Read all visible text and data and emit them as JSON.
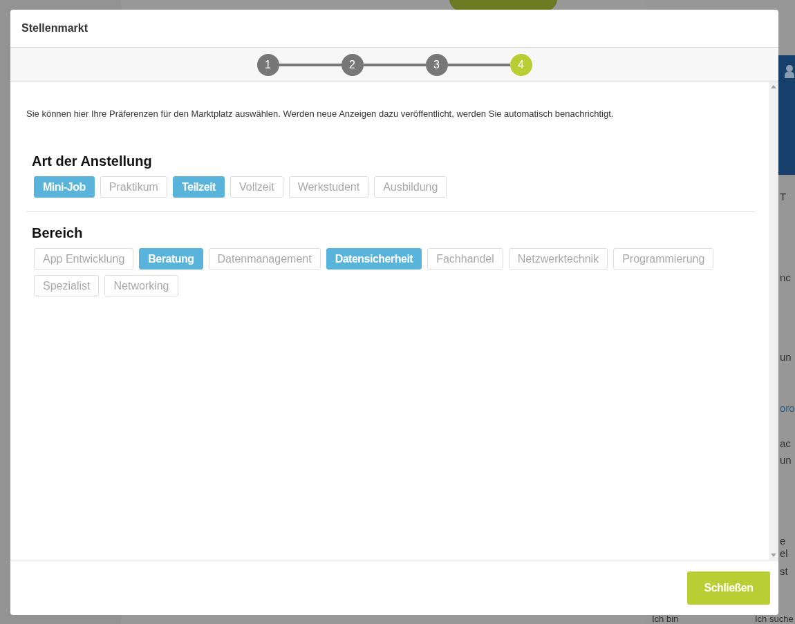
{
  "background": {
    "fragments": [
      {
        "text": "T",
        "kind": "text"
      },
      {
        "text": "nc",
        "kind": "text"
      },
      {
        "text": "un",
        "kind": "text"
      },
      {
        "text": "oro",
        "kind": "link"
      },
      {
        "text": "ac",
        "kind": "text"
      },
      {
        "text": "un",
        "kind": "text"
      },
      {
        "text": "e",
        "kind": "text"
      },
      {
        "text": "el",
        "kind": "text"
      },
      {
        "text": "st",
        "kind": "text"
      },
      {
        "text": "Ich bin",
        "kind": "text"
      },
      {
        "text": "Ich suche",
        "kind": "text"
      }
    ]
  },
  "modal": {
    "title": "Stellenmarkt",
    "steps": [
      {
        "label": "1",
        "selected": false
      },
      {
        "label": "2",
        "selected": false
      },
      {
        "label": "3",
        "selected": false
      },
      {
        "label": "4",
        "selected": true
      }
    ],
    "intro": "Sie können hier Ihre Präferenzen für den Marktplatz auswählen. Werden neue Anzeigen dazu veröffentlicht, werden Sie automatisch benachrichtigt.",
    "sections": [
      {
        "heading": "Art der Anstellung",
        "options": [
          {
            "label": "Mini-Job",
            "selected": true
          },
          {
            "label": "Praktikum",
            "selected": false
          },
          {
            "label": "Teilzeit",
            "selected": true
          },
          {
            "label": "Vollzeit",
            "selected": false
          },
          {
            "label": "Werkstudent",
            "selected": false
          },
          {
            "label": "Ausbildung",
            "selected": false
          }
        ]
      },
      {
        "heading": "Bereich",
        "options": [
          {
            "label": "App Entwicklung",
            "selected": false
          },
          {
            "label": "Beratung",
            "selected": true
          },
          {
            "label": "Datenmanagement",
            "selected": false
          },
          {
            "label": "Datensicherheit",
            "selected": true
          },
          {
            "label": "Fachhandel",
            "selected": false
          },
          {
            "label": "Netzwerktechnik",
            "selected": false
          },
          {
            "label": "Programmierung",
            "selected": false
          },
          {
            "label": "Spezialist",
            "selected": false
          },
          {
            "label": "Networking",
            "selected": false
          }
        ]
      }
    ],
    "close_button": "Schließen"
  }
}
